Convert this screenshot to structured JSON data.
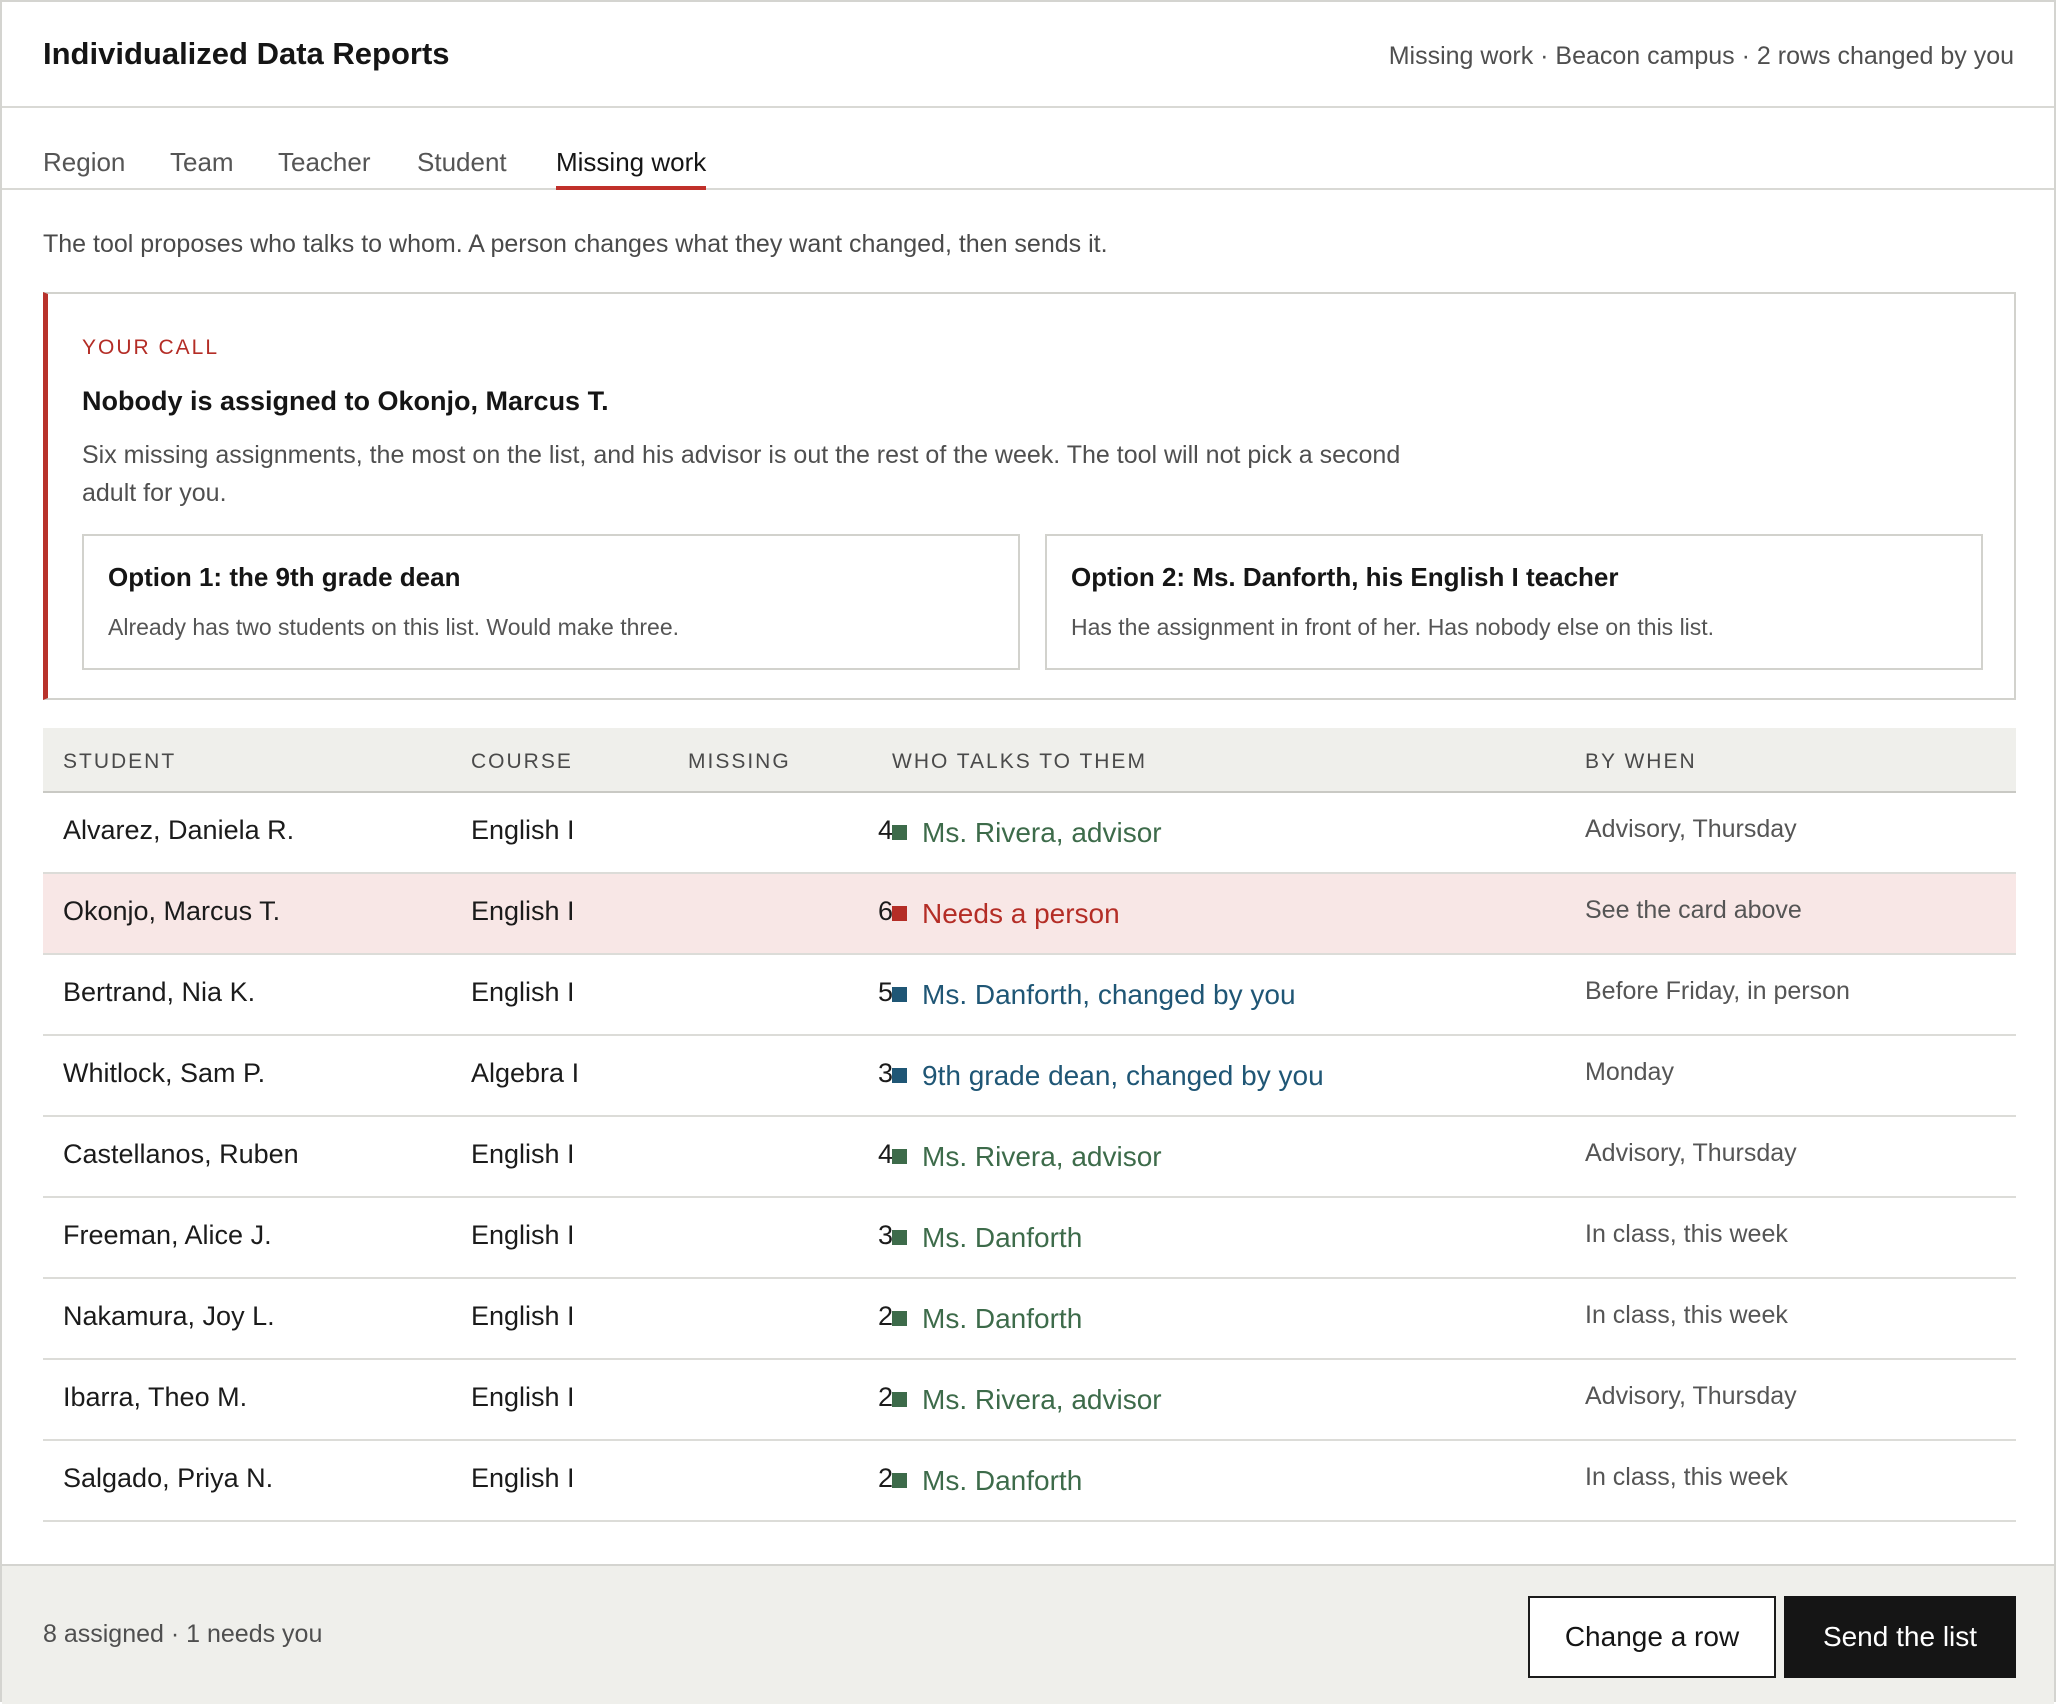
{
  "header": {
    "title": "Individualized Data Reports",
    "meta": "Missing work · Beacon campus · 2 rows changed by you"
  },
  "tabs": [
    {
      "label": "Region"
    },
    {
      "label": "Team"
    },
    {
      "label": "Teacher"
    },
    {
      "label": "Student"
    },
    {
      "label": "Missing work",
      "active": true
    }
  ],
  "intro": "The tool proposes who talks to whom. A person changes what they want changed, then sends it.",
  "call": {
    "eyebrow": "YOUR CALL",
    "title": "Nobody is assigned to Okonjo, Marcus T.",
    "description": "Six missing assignments, the most on the list, and his advisor is out the rest of the week. The tool will not pick a second adult for you.",
    "options": [
      {
        "title": "Option 1: the 9th grade dean",
        "description": "Already has two students on this list. Would make three."
      },
      {
        "title": "Option 2: Ms. Danforth, his English I teacher",
        "description": "Has the assignment in front of her. Has nobody else on this list."
      }
    ]
  },
  "table": {
    "headers": {
      "student": "STUDENT",
      "course": "COURSE",
      "missing": "MISSING",
      "who": "WHO TALKS TO THEM",
      "when": "BY WHEN"
    },
    "rows": [
      {
        "student": "Alvarez, Daniela R.",
        "course": "English I",
        "missing": "4",
        "who": "Ms. Rivera, advisor",
        "when": "Advisory, Thursday"
      },
      {
        "student": "Okonjo, Marcus T.",
        "course": "English I",
        "missing": "6",
        "who": "Needs a person",
        "when": "See the card above"
      },
      {
        "student": "Bertrand, Nia K.",
        "course": "English I",
        "missing": "5",
        "who": "Ms. Danforth, changed by you",
        "when": "Before Friday, in person"
      },
      {
        "student": "Whitlock, Sam P.",
        "course": "Algebra I",
        "missing": "3",
        "who": "9th grade dean, changed by you",
        "when": "Monday"
      },
      {
        "student": "Castellanos, Ruben",
        "course": "English I",
        "missing": "4",
        "who": "Ms. Rivera, advisor",
        "when": "Advisory, Thursday"
      },
      {
        "student": "Freeman, Alice J.",
        "course": "English I",
        "missing": "3",
        "who": "Ms. Danforth",
        "when": "In class, this week"
      },
      {
        "student": "Nakamura, Joy L.",
        "course": "English I",
        "missing": "2",
        "who": "Ms. Danforth",
        "when": "In class, this week"
      },
      {
        "student": "Ibarra, Theo M.",
        "course": "English I",
        "missing": "2",
        "who": "Ms. Rivera, advisor",
        "when": "Advisory, Thursday"
      },
      {
        "student": "Salgado, Priya N.",
        "course": "English I",
        "missing": "2",
        "who": "Ms. Danforth",
        "when": "In class, this week"
      }
    ]
  },
  "footer": {
    "summary": "8 assigned · 1 needs you",
    "change_label": "Change a row",
    "send_label": "Send the list"
  },
  "colors": {
    "accent_red": "#b42d26",
    "assigned_green": "#3d6b4a",
    "changed_blue": "#1f5675",
    "flag_row_bg": "#f8e7e6"
  }
}
